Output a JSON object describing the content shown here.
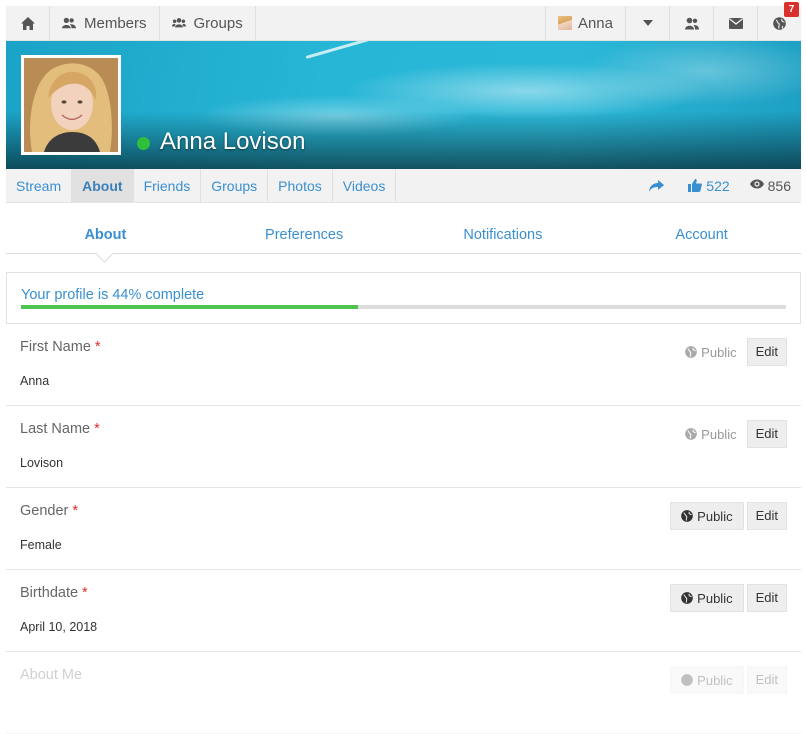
{
  "topnav": {
    "members_label": "Members",
    "groups_label": "Groups",
    "user_label": "Anna",
    "notification_count": "7"
  },
  "profile": {
    "name": "Anna Lovison",
    "status_color": "#2fbf3b"
  },
  "profile_tabs": [
    {
      "label": "Stream"
    },
    {
      "label": "About"
    },
    {
      "label": "Friends"
    },
    {
      "label": "Groups"
    },
    {
      "label": "Photos"
    },
    {
      "label": "Videos"
    }
  ],
  "stats": {
    "likes": "522",
    "views": "856"
  },
  "section_tabs": [
    {
      "label": "About"
    },
    {
      "label": "Preferences"
    },
    {
      "label": "Notifications"
    },
    {
      "label": "Account"
    }
  ],
  "progress": {
    "text": "Your profile is 44% complete",
    "percent": 44
  },
  "fields": [
    {
      "label": "First Name",
      "required": "*",
      "value": "Anna",
      "privacy": "Public",
      "edit": "Edit"
    },
    {
      "label": "Last Name",
      "required": "*",
      "value": "Lovison",
      "privacy": "Public",
      "edit": "Edit"
    },
    {
      "label": "Gender",
      "required": "*",
      "value": "Female",
      "privacy": "Public",
      "edit": "Edit"
    },
    {
      "label": "Birthdate",
      "required": "*",
      "value": "April 10, 2018",
      "privacy": "Public",
      "edit": "Edit"
    },
    {
      "label": "About Me",
      "privacy": "Public",
      "edit": "Edit"
    }
  ],
  "colors": {
    "accent": "#3a8fd0",
    "progress_fill": "#4fc34f",
    "required": "#d9302b",
    "badge": "#d9302b"
  }
}
